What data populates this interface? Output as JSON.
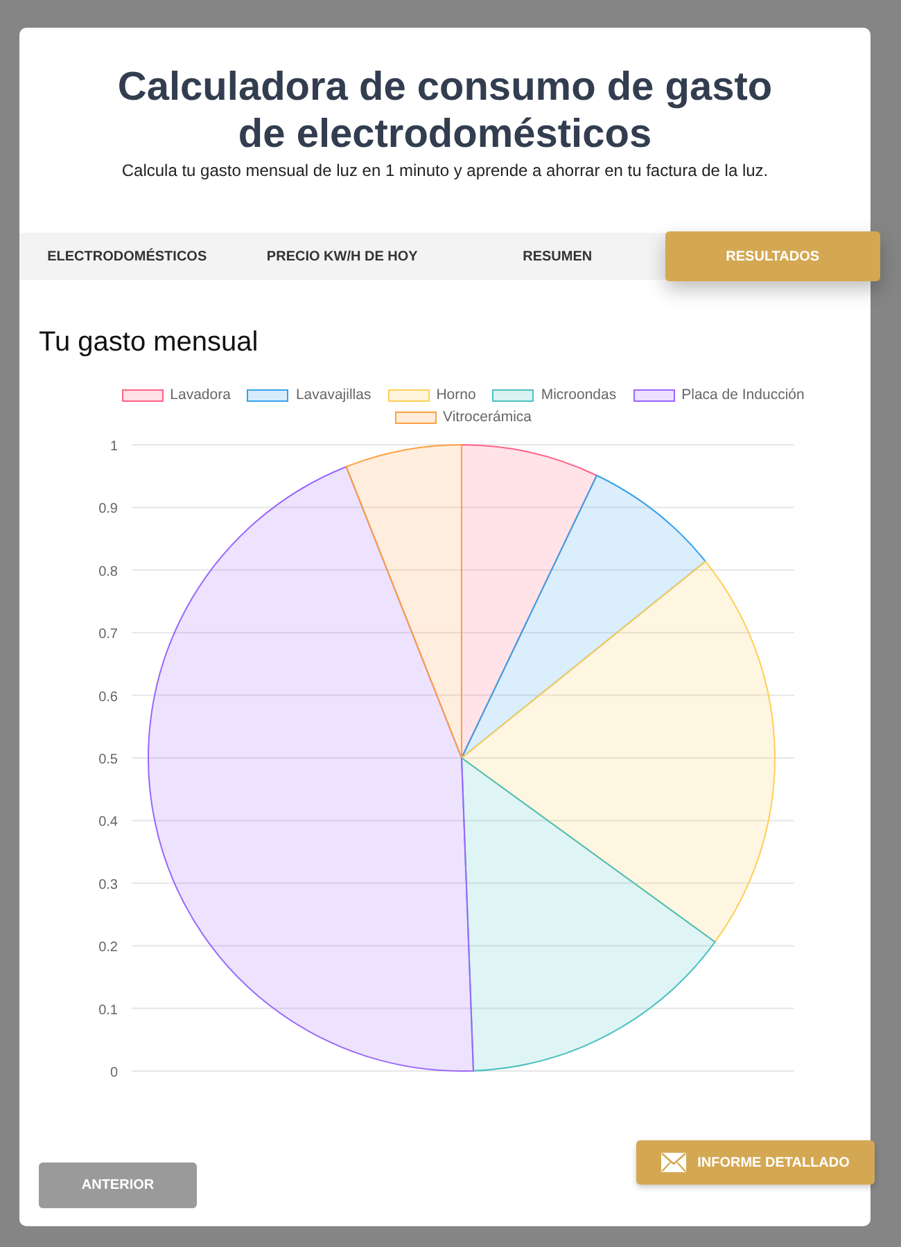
{
  "header": {
    "title": "Calculadora de consumo de gasto de electrodomésticos",
    "subtitle": "Calcula tu gasto mensual de luz en 1 minuto y aprende a ahorrar en tu factura de la luz."
  },
  "tabs": [
    {
      "label": "ELECTRODOMÉSTICOS",
      "selected": false
    },
    {
      "label": "PRECIO KW/H DE HOY",
      "selected": false
    },
    {
      "label": "RESUMEN",
      "selected": false
    },
    {
      "label": "RESULTADOS",
      "selected": true
    }
  ],
  "section_title": "Tu gasto mensual",
  "chart_data": {
    "type": "pie",
    "categories": [
      "Lavadora",
      "Lavavajillas",
      "Horno",
      "Microondas",
      "Placa de Inducción",
      "Vitrocerámica"
    ],
    "series": [
      {
        "colors": [
          "#ff6384",
          "#36a2eb",
          "#ffce56",
          "#4bc0c0",
          "#9966ff",
          "#ff9f40"
        ],
        "values": [
          7.1,
          7.1,
          20.8,
          14.4,
          44.6,
          6.0
        ]
      }
    ]
  },
  "axis_labels": [
    "1",
    "0.9",
    "0.8",
    "0.7",
    "0.6",
    "0.5",
    "0.4",
    "0.3",
    "0.2",
    "0.1",
    "0"
  ],
  "buttons": {
    "previous": "ANTERIOR",
    "report": "INFORME DETALLADO"
  }
}
